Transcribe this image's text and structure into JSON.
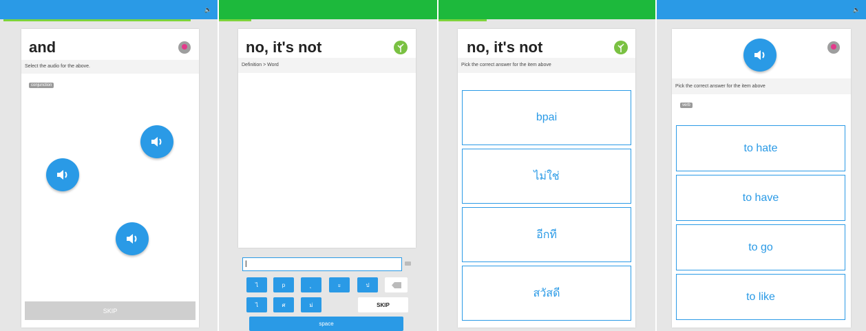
{
  "colors": {
    "blue": "#2a9ae6",
    "green": "#1db93c",
    "progress_green": "#7dd43b"
  },
  "panel1": {
    "word": "and",
    "instruction": "Select the audio for the above.",
    "tag": "conjunction",
    "skip_label": "SKIP",
    "audio_buttons": [
      "speaker-icon",
      "speaker-icon",
      "speaker-icon"
    ],
    "badge_icon": "flower-icon"
  },
  "panel2": {
    "word": "no, it's not",
    "instruction": "Definition > Word",
    "input_value": "|",
    "keys_row1": [
      "ไ",
      "p",
      "ุ",
      "ะ",
      "ป"
    ],
    "keys_row2": [
      "ไ",
      "ศ",
      "ม่"
    ],
    "skip_label": "SKIP",
    "space_label": "space",
    "badge_icon": "sprout-icon"
  },
  "panel3": {
    "word": "no, it's not",
    "instruction": "Pick the correct answer for the item above",
    "answers": [
      "bpai",
      "ไม่ใช่",
      "อีกที",
      "สวัสดี"
    ],
    "badge_icon": "sprout-icon"
  },
  "panel4": {
    "instruction": "Pick the correct answer for the item above",
    "tag": "verb",
    "answers": [
      "to hate",
      "to have",
      "to go",
      "to like"
    ],
    "badge_icon": "flower-icon"
  }
}
